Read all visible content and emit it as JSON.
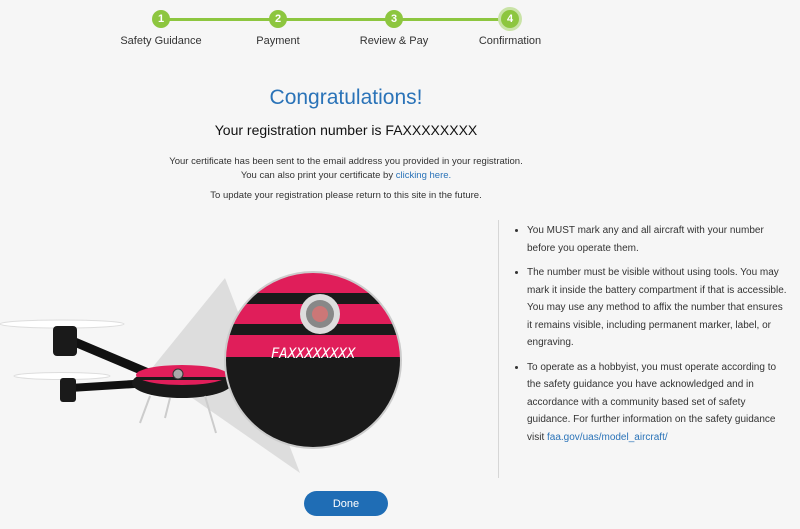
{
  "steps": [
    {
      "number": "1",
      "label": "Safety Guidance"
    },
    {
      "number": "2",
      "label": "Payment"
    },
    {
      "number": "3",
      "label": "Review & Pay"
    },
    {
      "number": "4",
      "label": "Confirmation"
    }
  ],
  "main": {
    "title": "Congratulations!",
    "registration_line": "Your registration number is FAXXXXXXXX",
    "cert_line1": "Your certificate has been sent to the email address you provided in your registration.",
    "cert_line2_prefix": "You can also print your certificate by ",
    "cert_link": "clicking here.",
    "update_line": "To update your registration please return to this site in the future."
  },
  "illustration": {
    "plate_text": "FAXXXXXXXX"
  },
  "bullets": {
    "b1": "You MUST mark any and all aircraft with your number before you operate them.",
    "b2": "The number must be visible without using tools. You may mark it inside the battery compartment if that is accessible. You may use any method to affix the number that ensures it remains visible, including permanent marker, label, or engraving.",
    "b3": "To operate as a hobbyist, you must operate according to the safety guidance you have acknowledged and in accordance with a community based set of safety guidance. For further information on the safety guidance visit ",
    "b3_link": "faa.gov/uas/model_aircraft/"
  },
  "done_label": "Done",
  "colors": {
    "step_green": "#8dc63f",
    "title_blue": "#2a73b8",
    "button_blue": "#1f6db5",
    "drone_pink": "#e01e5a"
  }
}
